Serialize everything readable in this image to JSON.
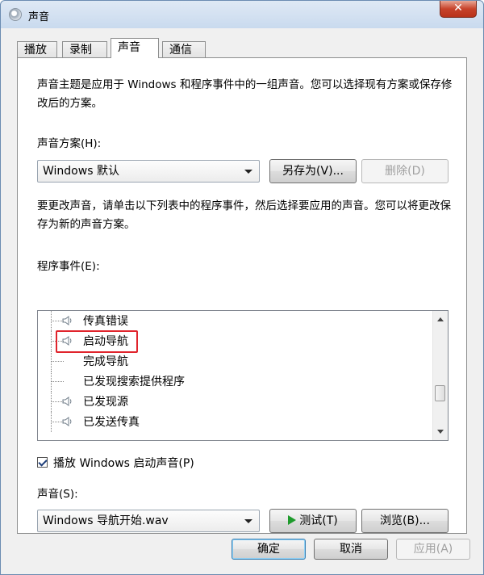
{
  "window": {
    "title": "声音",
    "close_glyph": "✕"
  },
  "tabs": [
    "播放",
    "录制",
    "声音",
    "通信"
  ],
  "active_tab": "声音",
  "intro_text": "声音主题是应用于 Windows 和程序事件中的一组声音。您可以选择现有方案或保存修改后的方案。",
  "scheme": {
    "label": "声音方案(H):",
    "selected": "Windows 默认",
    "save_as_label": "另存为(V)...",
    "delete_label": "删除(D)"
  },
  "change_text": "要更改声音，请单击以下列表中的程序事件，然后选择要应用的声音。您可以将更改保存为新的声音方案。",
  "events": {
    "label": "程序事件(E):",
    "items": [
      {
        "label": "传真错误",
        "has_sound": true
      },
      {
        "label": "启动导航",
        "has_sound": true,
        "selected": true
      },
      {
        "label": "完成导航",
        "has_sound": false
      },
      {
        "label": "已发现搜索提供程序",
        "has_sound": false
      },
      {
        "label": "已发现源",
        "has_sound": true
      },
      {
        "label": "已发送传真",
        "has_sound": true
      }
    ]
  },
  "startup_sound": {
    "label": "播放 Windows 启动声音(P)",
    "checked": true
  },
  "sound": {
    "label": "声音(S):",
    "selected": "Windows 导航开始.wav",
    "test_label": "测试(T)",
    "browse_label": "浏览(B)..."
  },
  "footer": {
    "ok_label": "确定",
    "cancel_label": "取消",
    "apply_label": "应用(A)"
  },
  "colors": {
    "highlight_border": "#e0242c",
    "play_icon": "#1e9b2c"
  }
}
